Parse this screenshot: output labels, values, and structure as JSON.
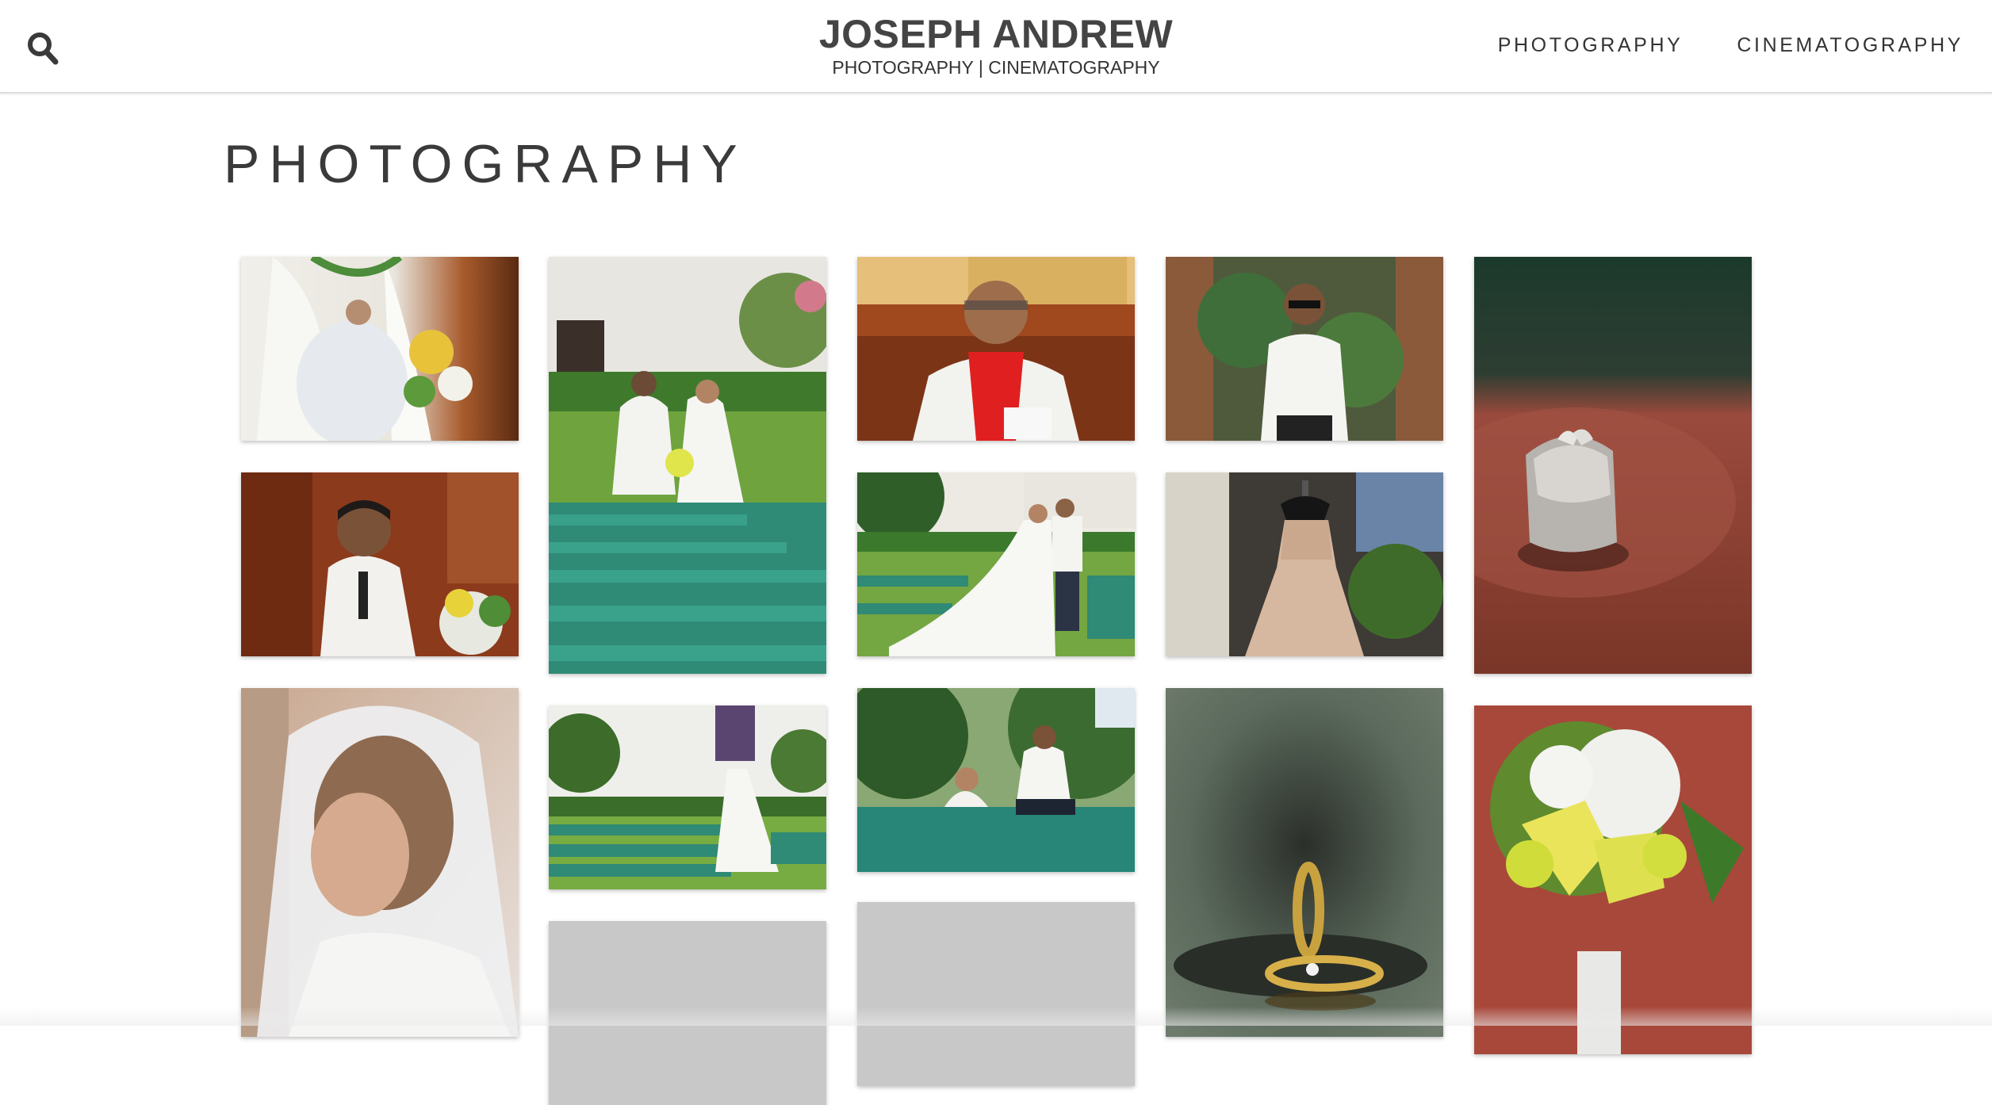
{
  "site": {
    "title": "JOSEPH ANDREW",
    "subtitle": "PHOTOGRAPHY | CINEMATOGRAPHY"
  },
  "nav": {
    "items": [
      {
        "label": "PHOTOGRAPHY"
      },
      {
        "label": "CINEMATOGRAPHY"
      }
    ]
  },
  "page": {
    "heading": "PHOTOGRAPHY"
  },
  "icons": {
    "search": "search-icon"
  },
  "colors": {
    "text": "#333333",
    "title": "#444444",
    "placeholder": "#c8c8c8"
  },
  "gallery": {
    "photos": [
      {
        "name": "bride-under-arch-photo"
      },
      {
        "name": "couple-in-church-garden-photo"
      },
      {
        "name": "priest-red-stole-photo"
      },
      {
        "name": "groom-sunglasses-photo"
      },
      {
        "name": "ring-box-photo"
      },
      {
        "name": "groom-at-altar-photo"
      },
      {
        "name": "couple-garden-long-train-photo"
      },
      {
        "name": "wedding-dress-on-mannequin-photo"
      },
      {
        "name": "bride-veil-portrait-photo"
      },
      {
        "name": "couple-church-facade-photo"
      },
      {
        "name": "couple-sitting-bench-photo"
      },
      {
        "name": "wedding-rings-photo"
      },
      {
        "name": "bridal-bouquet-photo"
      },
      {
        "name": "loading-photo-placeholder"
      },
      {
        "name": "loading-photo-placeholder"
      }
    ]
  }
}
